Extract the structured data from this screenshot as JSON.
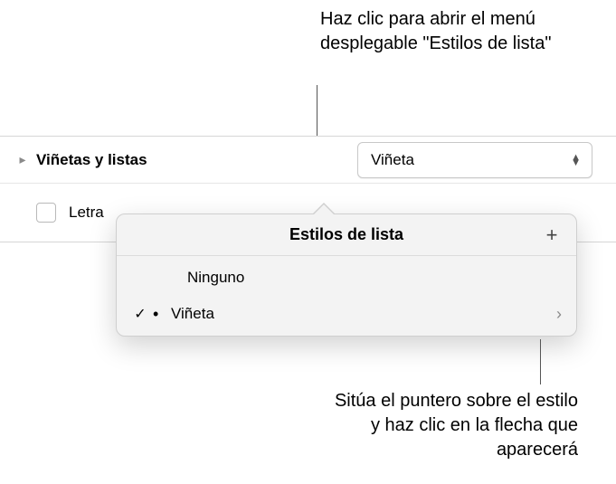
{
  "callouts": {
    "top": "Haz clic para abrir el menú desplegable \"Estilos de lista\"",
    "bottom": "Sitúa el puntero sobre el estilo y haz clic en la flecha que aparecerá"
  },
  "panel": {
    "bullets_and_lists_label": "Viñetas y listas",
    "popup_selected": "Viñeta",
    "lettered_label": "Letra"
  },
  "popover": {
    "title": "Estilos de lista",
    "items": [
      {
        "name": "Ninguno",
        "selected": false,
        "bullet": ""
      },
      {
        "name": "Viñeta",
        "selected": true,
        "bullet": "•"
      }
    ],
    "add_glyph": "+",
    "check_glyph": "✓",
    "arrow_glyph": "›"
  }
}
